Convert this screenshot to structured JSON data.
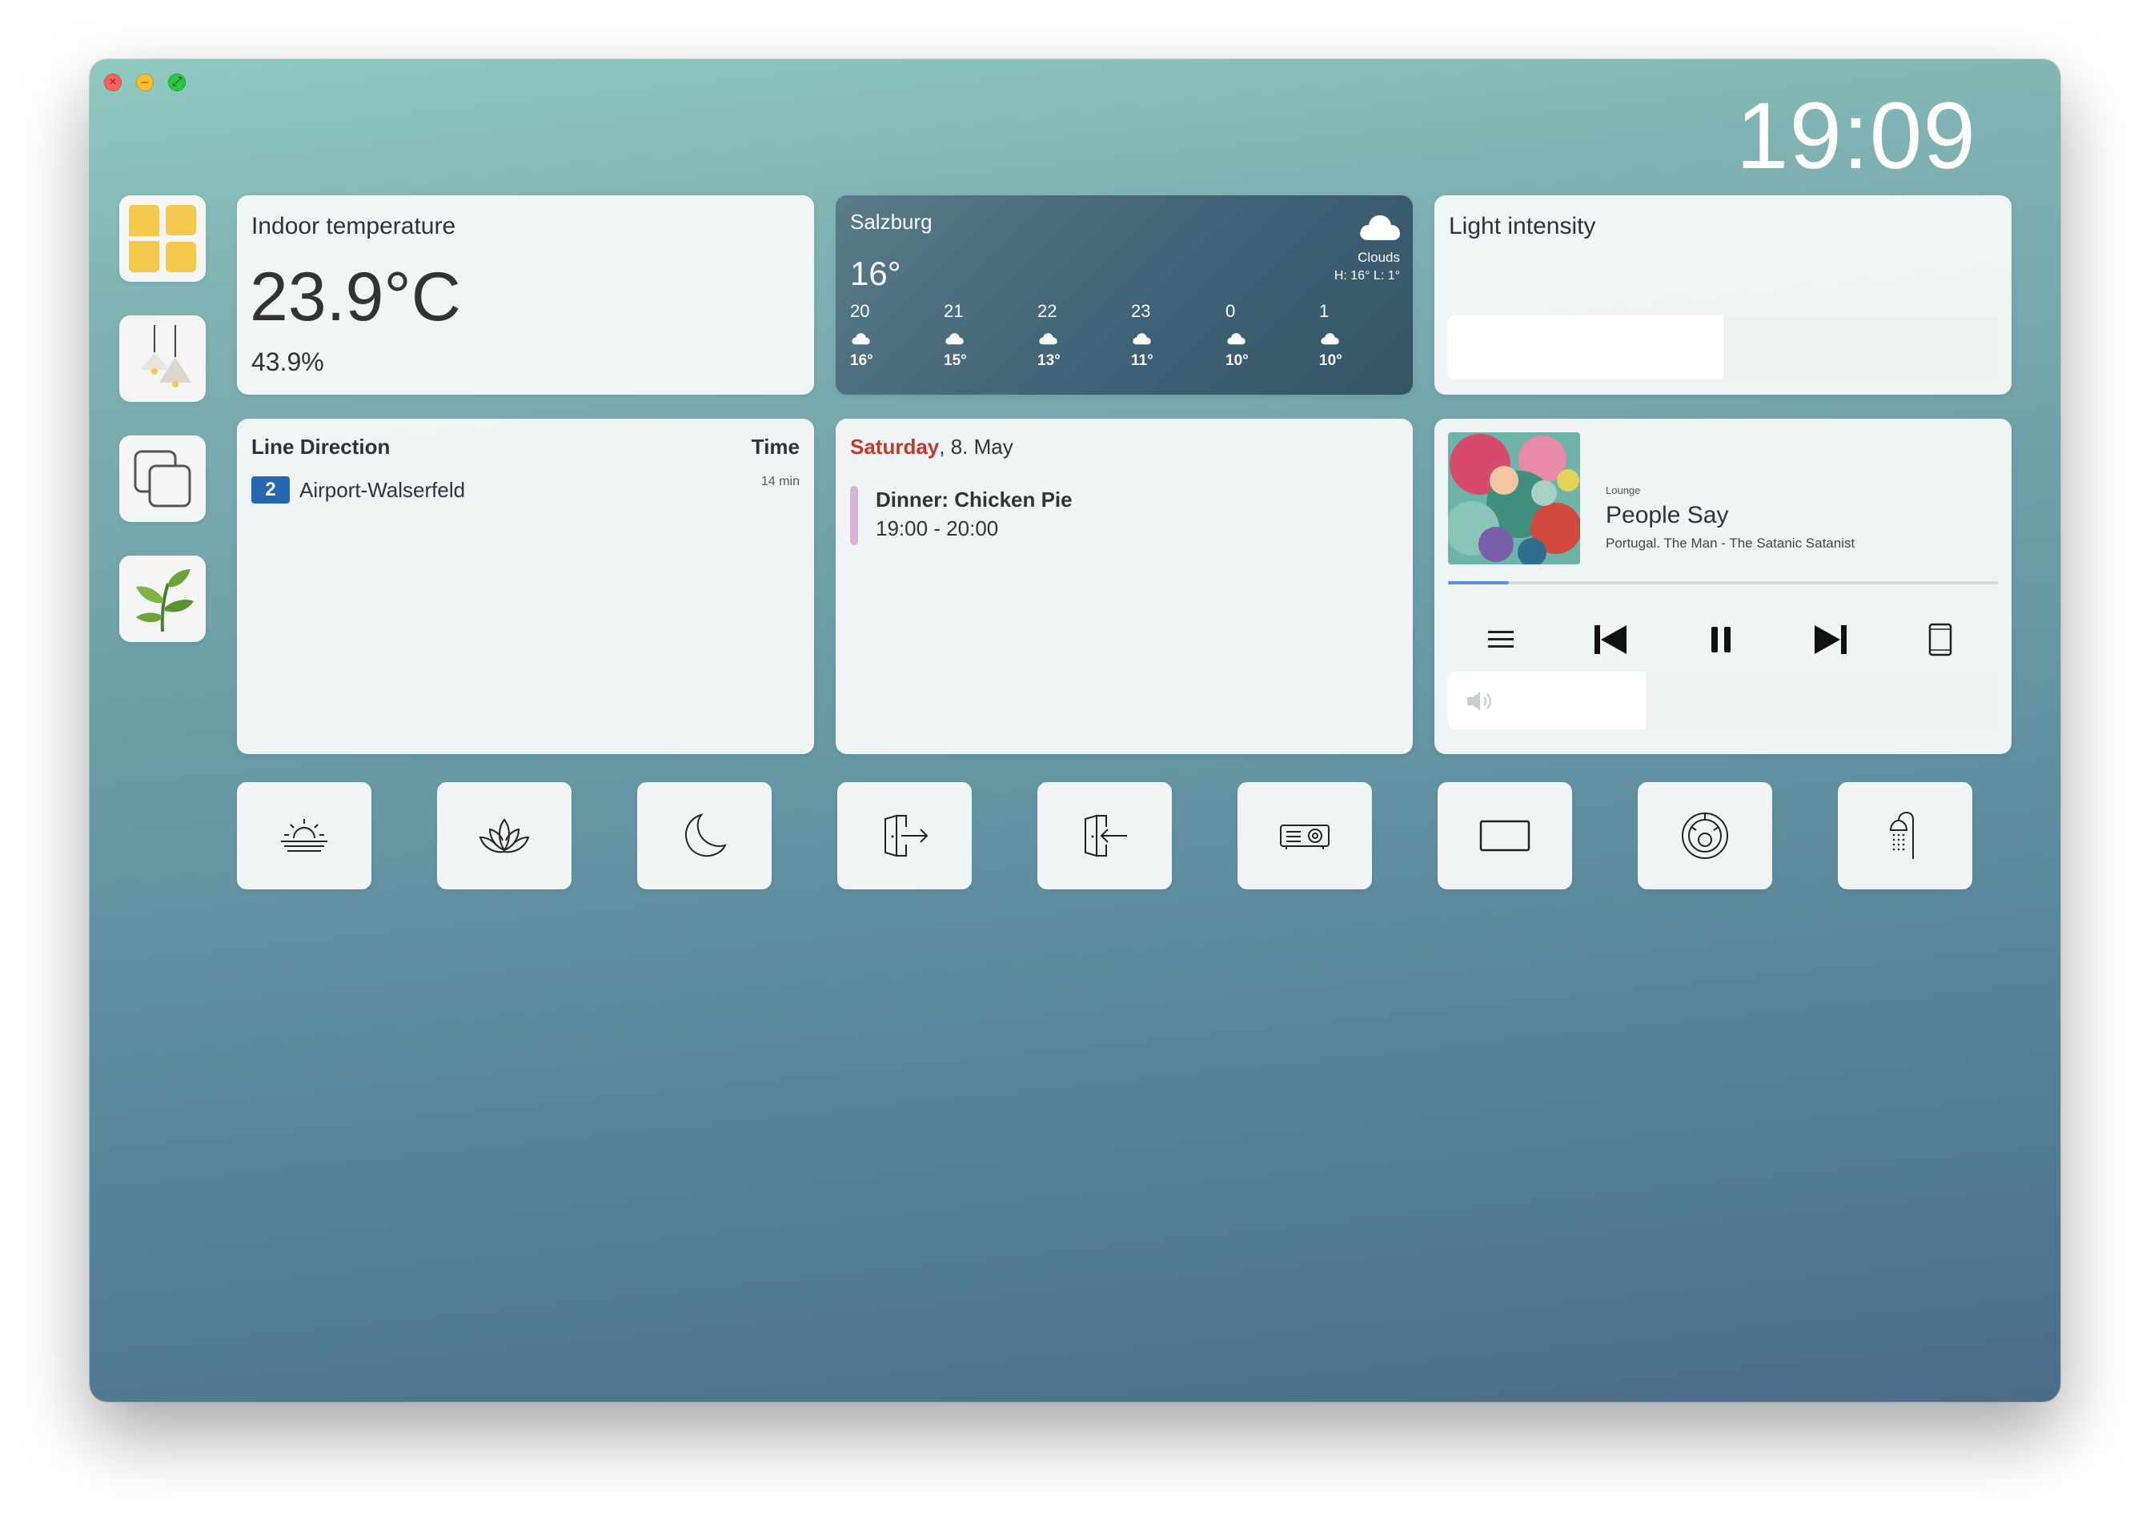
{
  "window": {
    "controls": [
      "close",
      "minimize",
      "fullscreen"
    ]
  },
  "clock": "19:09",
  "sidebar": {
    "items": [
      {
        "name": "dashboard",
        "icon": "dashboard-tiles-icon"
      },
      {
        "name": "lights",
        "icon": "pendant-lamps-icon"
      },
      {
        "name": "devices",
        "icon": "copy-squares-icon"
      },
      {
        "name": "plants",
        "icon": "plant-leaves-icon"
      }
    ]
  },
  "indoor": {
    "title": "Indoor temperature",
    "temperature": "23.9°C",
    "humidity": "43.9%"
  },
  "weather": {
    "city": "Salzburg",
    "temp": "16°",
    "condition": "Clouds",
    "high_low": "H: 16° L: 1°",
    "forecast": [
      {
        "hour": "20",
        "temp": "16°"
      },
      {
        "hour": "21",
        "temp": "15°"
      },
      {
        "hour": "22",
        "temp": "13°"
      },
      {
        "hour": "23",
        "temp": "11°"
      },
      {
        "hour": "0",
        "temp": "10°"
      },
      {
        "hour": "1",
        "temp": "10°"
      }
    ]
  },
  "light": {
    "title": "Light intensity",
    "level": 0.5
  },
  "transit": {
    "header_line": "Line",
    "header_direction": "Direction",
    "header_time": "Time",
    "departures": [
      {
        "line": "2",
        "direction": "Airport-Walserfeld",
        "time": "14 min"
      }
    ]
  },
  "calendar": {
    "day": "Saturday",
    "date": ", 8. May",
    "event_title": "Dinner: Chicken Pie",
    "event_time": "19:00 - 20:00",
    "event_color": "#d8b3d6"
  },
  "media": {
    "source": "Lounge",
    "title": "People Say",
    "artist": "Portugal. The Man - The Satanic Satanist",
    "progress": 0.11,
    "volume": 0.36,
    "controls": [
      "queue-icon",
      "previous-icon",
      "pause-icon",
      "next-icon",
      "tablet-icon"
    ]
  },
  "scenes": [
    "sunrise-icon",
    "lotus-icon",
    "moon-icon",
    "door-exit-icon",
    "door-enter-icon",
    "projector-icon",
    "screen-rectangle-icon",
    "robot-vacuum-icon",
    "shower-icon"
  ],
  "colors": {
    "accent_blue": "#2566b1",
    "calendar_red": "#c0392b",
    "progress_blue": "#5d8fd6"
  }
}
